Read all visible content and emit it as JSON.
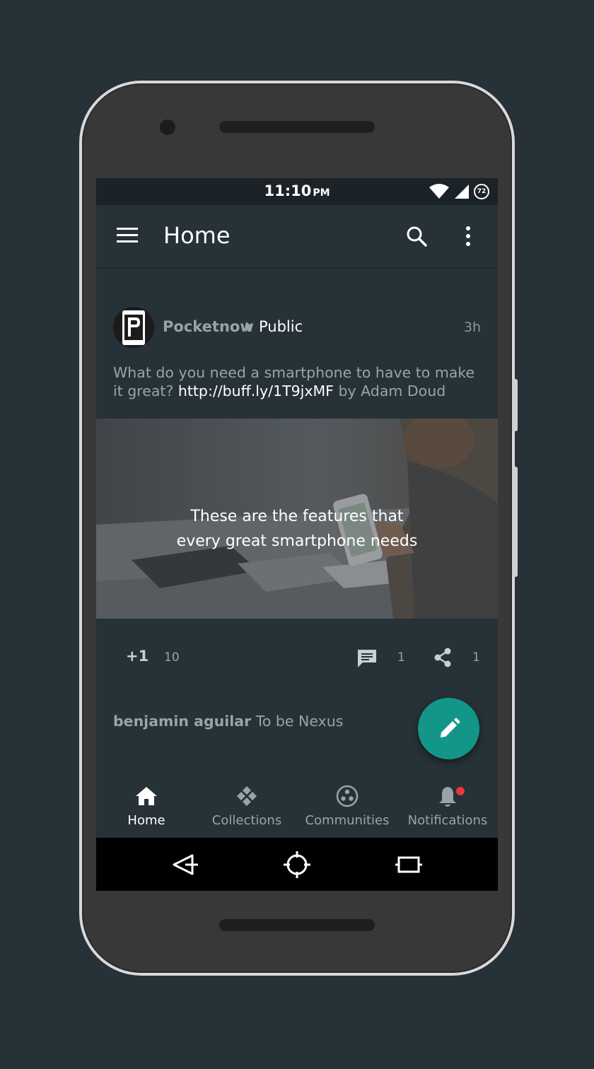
{
  "status_bar": {
    "time": "11:10",
    "ampm": "PM",
    "battery_level": "72",
    "icons": [
      "wifi-icon",
      "signal-icon",
      "battery-icon"
    ]
  },
  "app_bar": {
    "title": "Home",
    "icons": [
      "menu-icon",
      "search-icon",
      "more-vert-icon"
    ]
  },
  "post": {
    "author": "Pocketnow",
    "audience": "Public",
    "time": "3h",
    "text_before_link": "What do you need a smartphone to have to make it great? ",
    "link": "http://buff.ly/1T9jxMF",
    "text_after_link": " by Adam Doud",
    "media_caption_line1": "These are the features that",
    "media_caption_line2": "every great smartphone needs",
    "plus_one_label": "+1",
    "plus_one_count": "10",
    "comment_count": "1",
    "share_count": "1"
  },
  "comment": {
    "author": "benjamin aguilar",
    "text": " To be Nexus"
  },
  "fab": {
    "icon": "edit-pencil-icon",
    "color": "#139688"
  },
  "bottom_nav": {
    "items": [
      {
        "label": "Home",
        "icon": "home-icon",
        "active": true
      },
      {
        "label": "Collections",
        "icon": "collections-icon",
        "active": false
      },
      {
        "label": "Communities",
        "icon": "communities-icon",
        "active": false
      },
      {
        "label": "Notifications",
        "icon": "bell-icon",
        "active": false,
        "badge": true
      }
    ]
  },
  "system_nav": {
    "icons": [
      "back-icon",
      "home-target-icon",
      "recents-icon"
    ]
  },
  "colors": {
    "background": "#263138",
    "accent": "#139688",
    "badge": "#e9373b"
  }
}
